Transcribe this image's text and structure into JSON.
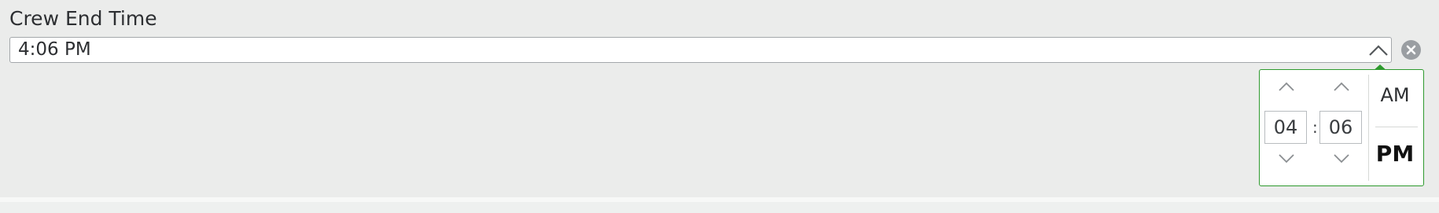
{
  "field": {
    "label": "Crew End Time",
    "value": "4:06 PM"
  },
  "icons": {
    "toggle": "chevron-up-icon",
    "clear": "clear-x-circle-icon",
    "step_up": "chevron-up-icon",
    "step_down": "chevron-down-icon"
  },
  "picker": {
    "hour": "04",
    "separator": ":",
    "minute": "06",
    "am_label": "AM",
    "pm_label": "PM",
    "selected_period": "PM"
  },
  "colors": {
    "accent": "#2e9a2e",
    "background": "#ebeceb"
  }
}
